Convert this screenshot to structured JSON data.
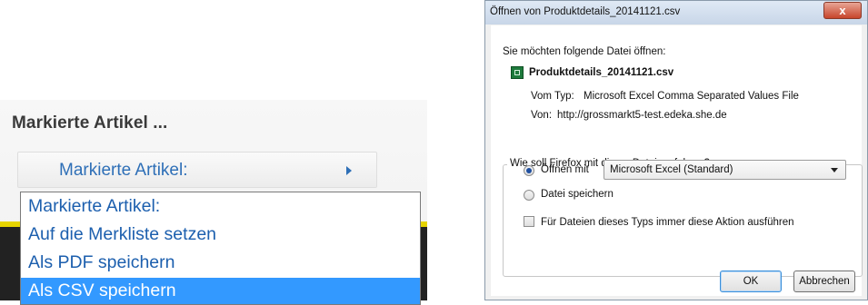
{
  "left": {
    "section_title": "Markierte Artikel ...",
    "select_label": "Markierte Artikel:",
    "options": [
      "Markierte Artikel:",
      "Auf die Merkliste setzen",
      "Als PDF speichern",
      "Als CSV speichern"
    ],
    "selected_index": 3
  },
  "dialog": {
    "title": "Öffnen von Produktdetails_20141121.csv",
    "close_label": "x",
    "prompt": "Sie möchten folgende Datei öffnen:",
    "filename": "Produktdetails_20141121.csv",
    "type_label": "Vom Typ:",
    "type_value": "Microsoft Excel Comma Separated Values File",
    "from_label": "Von:",
    "from_value": "http://grossmarkt5-test.edeka.she.de",
    "question": "Wie soll Firefox mit dieser Datei verfahren?",
    "open_with_label": "Öffnen mit",
    "open_with_value": "Microsoft Excel (Standard)",
    "save_label": "Datei speichern",
    "remember_label": "Für Dateien dieses Typs immer diese Aktion ausführen",
    "ok_label": "OK",
    "cancel_label": "Abbrechen"
  }
}
